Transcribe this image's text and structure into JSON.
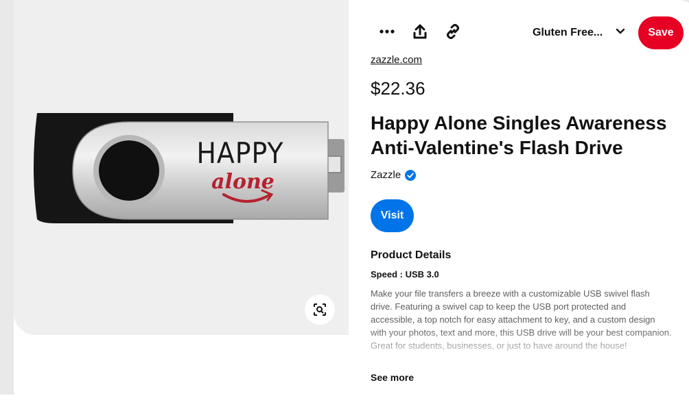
{
  "toolbar": {
    "more_icon": "more-horizontal-icon",
    "share_icon": "share-icon",
    "link_icon": "link-icon",
    "board_selector": "Gluten Free...",
    "board_chevron_icon": "chevron-down-icon",
    "save_label": "Save"
  },
  "image": {
    "product_text_line1": "HAPPY",
    "product_text_line2": "alone",
    "lens_icon": "visual-search-icon"
  },
  "pin": {
    "source": "zazzle.com",
    "price": "$22.36",
    "title": "Happy Alone Singles Awareness Anti-Valentine's Flash Drive",
    "merchant": "Zazzle",
    "verified_icon": "verified-check-icon",
    "visit_label": "Visit"
  },
  "details": {
    "section_title": "Product Details",
    "spec": "Speed : USB 3.0",
    "description": "Make your file transfers a breeze with a customizable USB swivel flash drive. Featuring a swivel cap to keep the USB port protected and accessible, a top notch for easy attachment to key, and a custom design with your photos, text and more, this USB drive will be your best companion. Great for students, businesses, or just to have around the house!",
    "see_more": "See more"
  },
  "colors": {
    "save_button": "#e60023",
    "visit_button": "#0074e8",
    "verified_badge": "#0074e8",
    "image_background": "#efefef"
  }
}
